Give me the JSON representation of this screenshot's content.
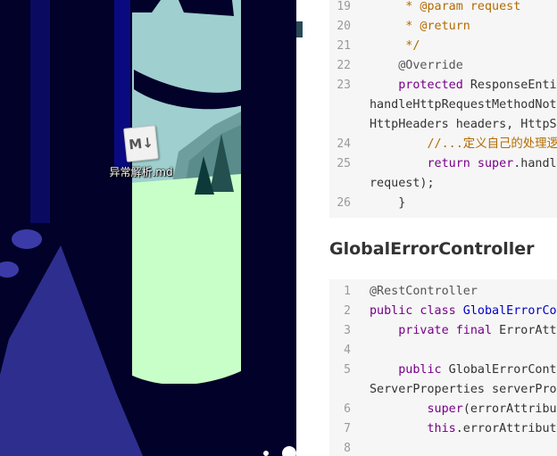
{
  "desktop": {
    "file_icon_glyph": "M↓",
    "file_label": "异常解析.md",
    "colors": {
      "night": "#020129",
      "sky": "#9fcfcf",
      "meadow": "#c8ffc8",
      "tree": "#2e2e8f",
      "hill": "#5a8c8c"
    }
  },
  "editor": {
    "block1": [
      {
        "num": "19",
        "text": "     * @param request"
      },
      {
        "num": "20",
        "text": "     * @return"
      },
      {
        "num": "21",
        "text": "     */"
      },
      {
        "num": "22",
        "text": "    @Override"
      },
      {
        "num": "23",
        "kw": "    protected",
        "rest": " ResponseEnti",
        "cont1": "handleHttpRequestMethodNot",
        "cont2": "HttpHeaders headers, HttpS"
      },
      {
        "num": "24",
        "text": "        //...定义自己的处理逻"
      },
      {
        "num": "25",
        "kw": "        return super",
        "rest": ".handl",
        "cont1": "request);"
      },
      {
        "num": "26",
        "text": "    }"
      }
    ],
    "heading": "GlobalErrorController",
    "block2": [
      {
        "num": "1",
        "text": "@RestController"
      },
      {
        "num": "2",
        "kw": "public class",
        "type": " GlobalErrorCo"
      },
      {
        "num": "3",
        "kw": "    private final",
        "rest": " ErrorAtt"
      },
      {
        "num": "4",
        "text": ""
      },
      {
        "num": "5",
        "kw": "    public",
        "rest": " GlobalErrorCont",
        "cont1": "ServerProperties serverPro"
      },
      {
        "num": "6",
        "kw": "        super",
        "rest": "(errorAttribu"
      },
      {
        "num": "7",
        "kw": "        this",
        "rest": ".errorAttribut"
      },
      {
        "num": "8",
        "text": ""
      }
    ]
  }
}
